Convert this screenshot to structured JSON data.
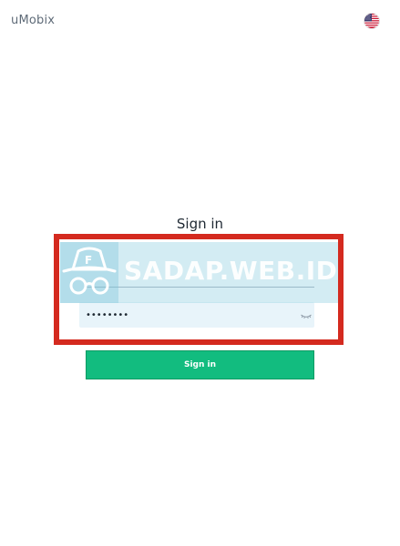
{
  "header": {
    "brand": "uMobix",
    "language_flag_icon": "us-flag-icon"
  },
  "form": {
    "title": "Sign in",
    "email_value": "",
    "password_value": "••••••••",
    "password_toggle_icon": "eye-closed-icon",
    "submit_label": "Sign in"
  },
  "watermark": {
    "text": "SADAP.WEB.ID",
    "logo_icon": "spy-hat-glasses-icon"
  },
  "colors": {
    "accent": "#12bc7f",
    "highlight_frame": "#d42a1f",
    "password_bg": "#e8f4fa",
    "watermark_tint": "#9ed4e4"
  }
}
